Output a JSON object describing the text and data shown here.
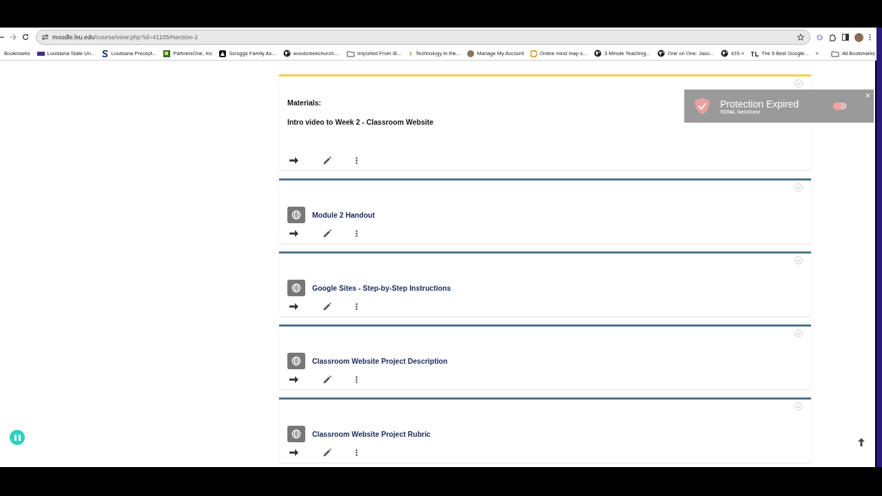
{
  "browser": {
    "url_host": "moodle.lsu.edu",
    "url_path": "/course/view.php?id=41105#section-2",
    "bookmarks": [
      {
        "label": "Bookmarks",
        "kind": "none"
      },
      {
        "label": "Louisiana State Un...",
        "kind": "lsu"
      },
      {
        "label": "Louisiana Precept...",
        "kind": "s"
      },
      {
        "label": "PartnersOne, Inc",
        "kind": "square"
      },
      {
        "label": "Scruggs Family As...",
        "kind": "dark"
      },
      {
        "label": "woodcreekchurch....",
        "kind": "globe"
      },
      {
        "label": "Imported From IE...",
        "kind": "folder"
      },
      {
        "label": "Technology In the...",
        "kind": "leaf"
      },
      {
        "label": "Manage My Account",
        "kind": "round"
      },
      {
        "label": "Online mind map s...",
        "kind": "hex"
      },
      {
        "label": "3 Minute Teaching...",
        "kind": "globe"
      },
      {
        "label": "One on One: Jaso...",
        "kind": "globe"
      },
      {
        "label": "iOS »",
        "kind": "globe"
      },
      {
        "label": "The 5 Best Google...",
        "kind": "tl"
      }
    ],
    "overflow": "»",
    "all_bookmarks": "All Bookmarks"
  },
  "toast": {
    "title": "Protection Expired",
    "brand": "**TOTAL** WebShield",
    "close": "×"
  },
  "sections": [
    {
      "kind": "label",
      "color": "#f0cf45",
      "lines": [
        "Materials:",
        "Intro video to Week 2 - Classroom Website"
      ]
    },
    {
      "kind": "url",
      "color": "#4b7289",
      "title": "Module 2 Handout"
    },
    {
      "kind": "url",
      "color": "#4b7289",
      "title": "Google Sites - Step-by-Step Instructions"
    },
    {
      "kind": "url",
      "color": "#4b7289",
      "title": "Classroom Website Project Description"
    },
    {
      "kind": "url",
      "color": "#4b7289",
      "title": "Classroom Website Project Rubric"
    }
  ]
}
